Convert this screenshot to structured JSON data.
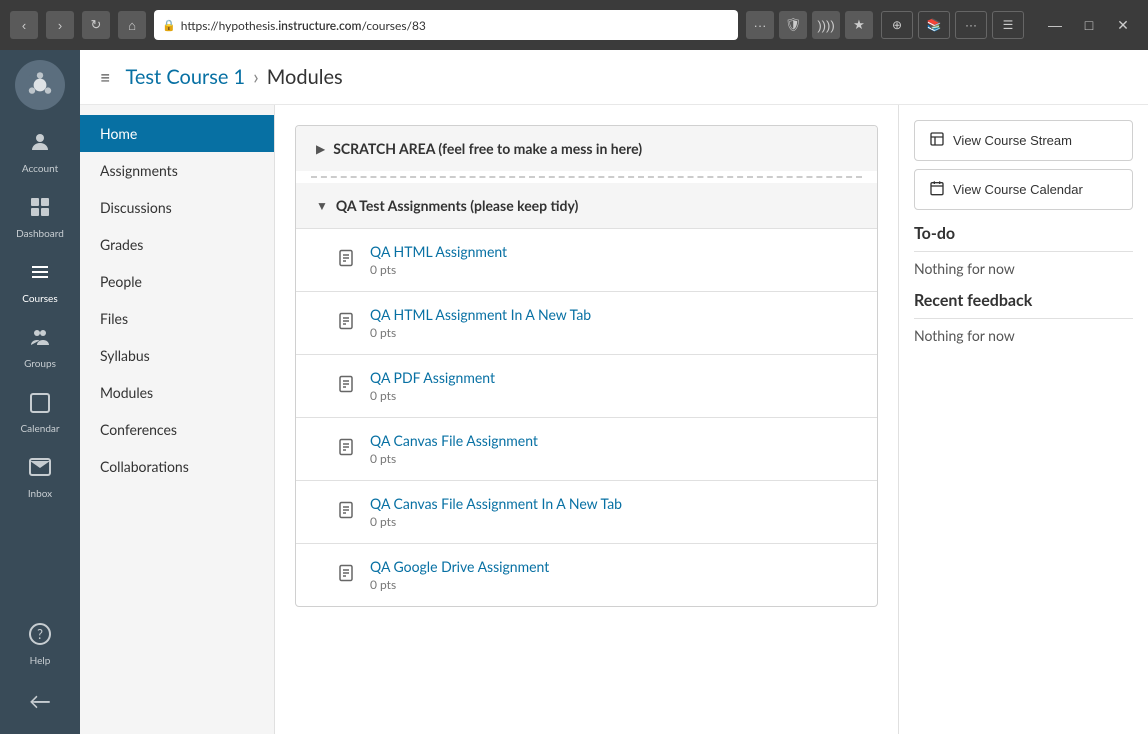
{
  "browser": {
    "url_prefix": "https://hypothesis.",
    "url_domain": "instructure.com",
    "url_path": "/courses/83",
    "nav_back": "‹",
    "nav_forward": "›",
    "nav_refresh": "↻",
    "nav_home": "⌂",
    "dots_menu": "···",
    "shield_icon": "🛡",
    "rss_icon": "📡",
    "star_icon": "★",
    "new_tab": "⊕",
    "bookmark": "📚",
    "extensions": "···",
    "menu_icon": "☰",
    "minimize": "—",
    "maximize": "□",
    "close": "✕"
  },
  "header": {
    "menu_label": "≡",
    "breadcrumb_parent": "Test Course 1",
    "breadcrumb_separator": "›",
    "breadcrumb_current": "Modules"
  },
  "global_nav": {
    "logo_alt": "Canvas",
    "items": [
      {
        "id": "account",
        "label": "Account",
        "icon": "👤"
      },
      {
        "id": "dashboard",
        "label": "Dashboard",
        "icon": "⊞"
      },
      {
        "id": "courses",
        "label": "Courses",
        "icon": "📖",
        "active": true
      },
      {
        "id": "groups",
        "label": "Groups",
        "icon": "👥"
      },
      {
        "id": "calendar",
        "label": "Calendar",
        "icon": "📅"
      },
      {
        "id": "inbox",
        "label": "Inbox",
        "icon": "✉"
      },
      {
        "id": "help",
        "label": "Help",
        "icon": "?"
      }
    ],
    "collapse_label": "←"
  },
  "course_nav": {
    "items": [
      {
        "id": "home",
        "label": "Home",
        "active": true
      },
      {
        "id": "assignments",
        "label": "Assignments"
      },
      {
        "id": "discussions",
        "label": "Discussions"
      },
      {
        "id": "grades",
        "label": "Grades"
      },
      {
        "id": "people",
        "label": "People"
      },
      {
        "id": "files",
        "label": "Files"
      },
      {
        "id": "syllabus",
        "label": "Syllabus"
      },
      {
        "id": "modules",
        "label": "Modules"
      },
      {
        "id": "conferences",
        "label": "Conferences"
      },
      {
        "id": "collaborations",
        "label": "Collaborations"
      }
    ]
  },
  "modules": [
    {
      "id": "scratch",
      "title": "SCRATCH AREA (feel free to make a mess in here)",
      "collapsed": true,
      "items": []
    },
    {
      "id": "qa",
      "title": "QA Test Assignments (please keep tidy)",
      "collapsed": false,
      "items": [
        {
          "id": "qa-html",
          "name": "QA HTML Assignment",
          "pts": "0 pts"
        },
        {
          "id": "qa-html-new-tab",
          "name": "QA HTML Assignment In A New Tab",
          "pts": "0 pts"
        },
        {
          "id": "qa-pdf",
          "name": "QA PDF Assignment",
          "pts": "0 pts"
        },
        {
          "id": "qa-canvas-file",
          "name": "QA Canvas File Assignment",
          "pts": "0 pts"
        },
        {
          "id": "qa-canvas-file-new-tab",
          "name": "QA Canvas File Assignment In A New Tab",
          "pts": "0 pts"
        },
        {
          "id": "qa-google-drive",
          "name": "QA Google Drive Assignment",
          "pts": "0 pts"
        }
      ]
    }
  ],
  "right_sidebar": {
    "view_course_stream_label": "View Course Stream",
    "view_course_stream_icon": "📊",
    "view_course_calendar_label": "View Course Calendar",
    "view_course_calendar_icon": "📅",
    "todo_title": "To-do",
    "todo_empty": "Nothing for now",
    "feedback_title": "Recent feedback",
    "feedback_empty": "Nothing for now"
  }
}
